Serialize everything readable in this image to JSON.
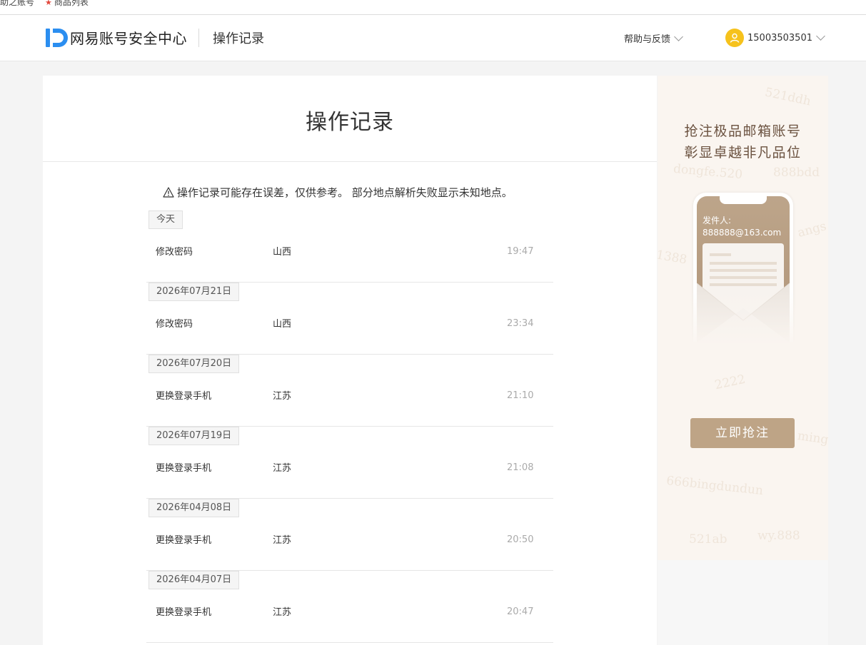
{
  "bookmarks": {
    "item1": "助之账号",
    "item2": "商品列表"
  },
  "header": {
    "brand": "网易账号安全中心",
    "subtitle": "操作记录",
    "help_label": "帮助与反馈",
    "user_phone": "15003503501",
    "avatar_color": "#f6c21c"
  },
  "main": {
    "title": "操作记录",
    "notice": "操作记录可能存在误差，仅供参考。 部分地点解析失败显示未知地点。",
    "records": [
      {
        "date": "今天",
        "action": "修改密码",
        "place": "山西",
        "time": "19:47"
      },
      {
        "date": "2026年07月21日",
        "action": "修改密码",
        "place": "山西",
        "time": "23:34"
      },
      {
        "date": "2026年07月20日",
        "action": "更换登录手机",
        "place": "江苏",
        "time": "21:10"
      },
      {
        "date": "2026年07月19日",
        "action": "更换登录手机",
        "place": "江苏",
        "time": "21:08"
      },
      {
        "date": "2026年04月08日",
        "action": "更换登录手机",
        "place": "江苏",
        "time": "20:50"
      },
      {
        "date": "2026年04月07日",
        "action": "更换登录手机",
        "place": "江苏",
        "time": "20:47"
      }
    ]
  },
  "ad": {
    "line1": "抢注极品邮箱账号",
    "line2": "彰显卓越非凡品位",
    "sender_label": "发件人:",
    "sender_email": "888888@163.com",
    "cta": "立即抢注",
    "watermarks": [
      "521ddh",
      "888bdd",
      "2222",
      "666bingdundun",
      "521ab",
      "wy.888",
      "dongfe.520",
      "1388",
      "ming",
      "angs"
    ],
    "accent_color": "#bea486"
  }
}
